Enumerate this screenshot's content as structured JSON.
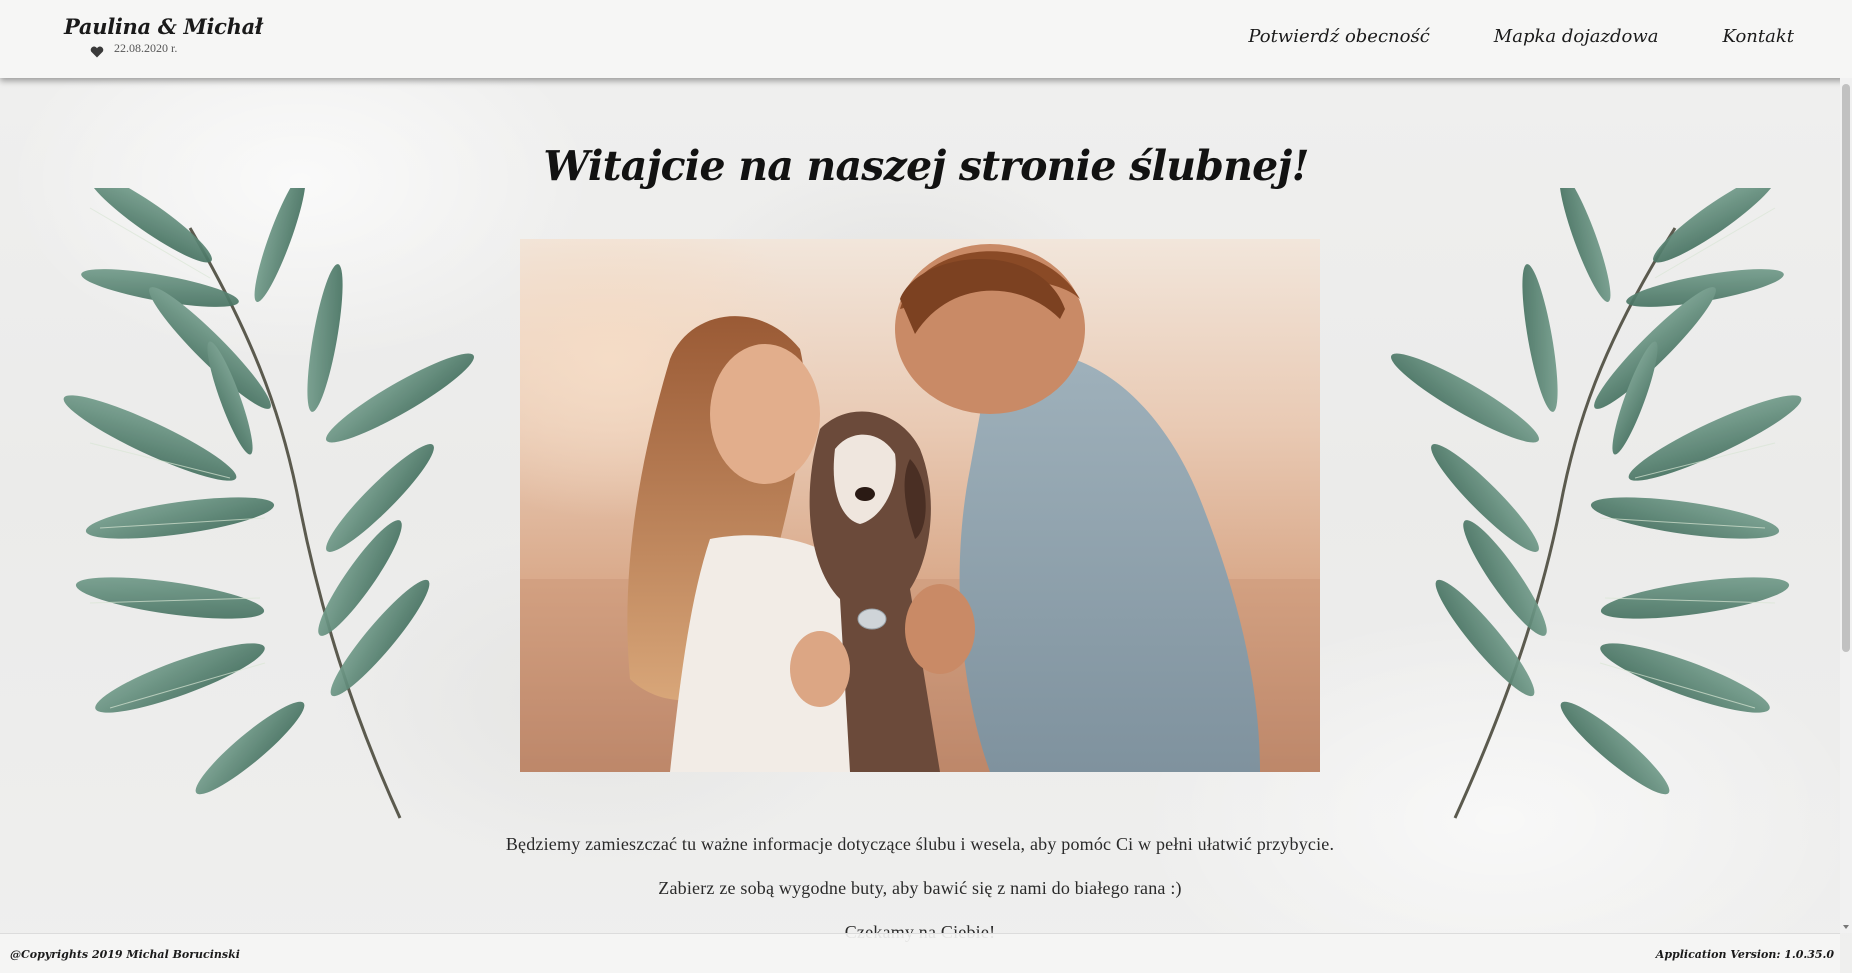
{
  "header": {
    "brand_names": "Paulina & Michał",
    "brand_date": "22.08.2020 r.",
    "heart_icon": "heart-icon",
    "nav": [
      {
        "label": "Potwierdź obecność"
      },
      {
        "label": "Mapka dojazdowa"
      },
      {
        "label": "Kontakt"
      }
    ]
  },
  "main": {
    "title": "Witajcie na naszej stronie ślubnej!",
    "lines": [
      "Będziemy zamieszczać tu ważne informacje dotyczące ślubu i wesela, aby pomóc Ci w pełni ułatwić przybycie.",
      "Zabierz ze sobą wygodne buty, aby bawić się z nami do białego rana :)",
      "Czekamy na Ciebie!"
    ]
  },
  "footer": {
    "copyright": "@Copyrights 2019 Michal Borucinski",
    "version": "Application Version: 1.0.35.0"
  },
  "colors": {
    "leaf": "#5f8b78",
    "leaf_dark": "#3f6b5a",
    "stem": "#5b5a4e"
  }
}
